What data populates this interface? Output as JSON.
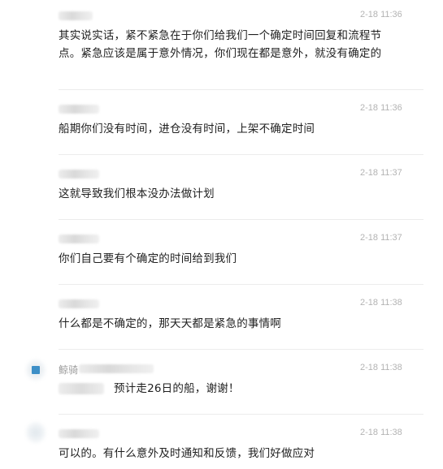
{
  "messages": [
    {
      "time": "2-18 11:36",
      "text": "其实说实话，紧不紧急在于你们给我们一个确定时间回复和流程节点。紧急应该是属于意外情况，你们现在都是意外，就没有确定的"
    },
    {
      "time": "2-18 11:36",
      "text": "船期你们没有时间，进仓没有时间，上架不确定时间"
    },
    {
      "time": "2-18 11:37",
      "text": "这就导致我们根本没办法做计划"
    },
    {
      "time": "2-18 11:37",
      "text": "你们自己要有个确定的时间给到我们"
    },
    {
      "time": "2-18 11:38",
      "text": "什么都是不确定的，那天天都是紧急的事情啊"
    },
    {
      "time": "2-18 11:38",
      "sender": "鲸骑",
      "text": "预计走26日的船，谢谢！"
    },
    {
      "time": "2-18 11:38",
      "text": "可以的。有什么意外及时通知和反馈，我们好做应对"
    }
  ]
}
